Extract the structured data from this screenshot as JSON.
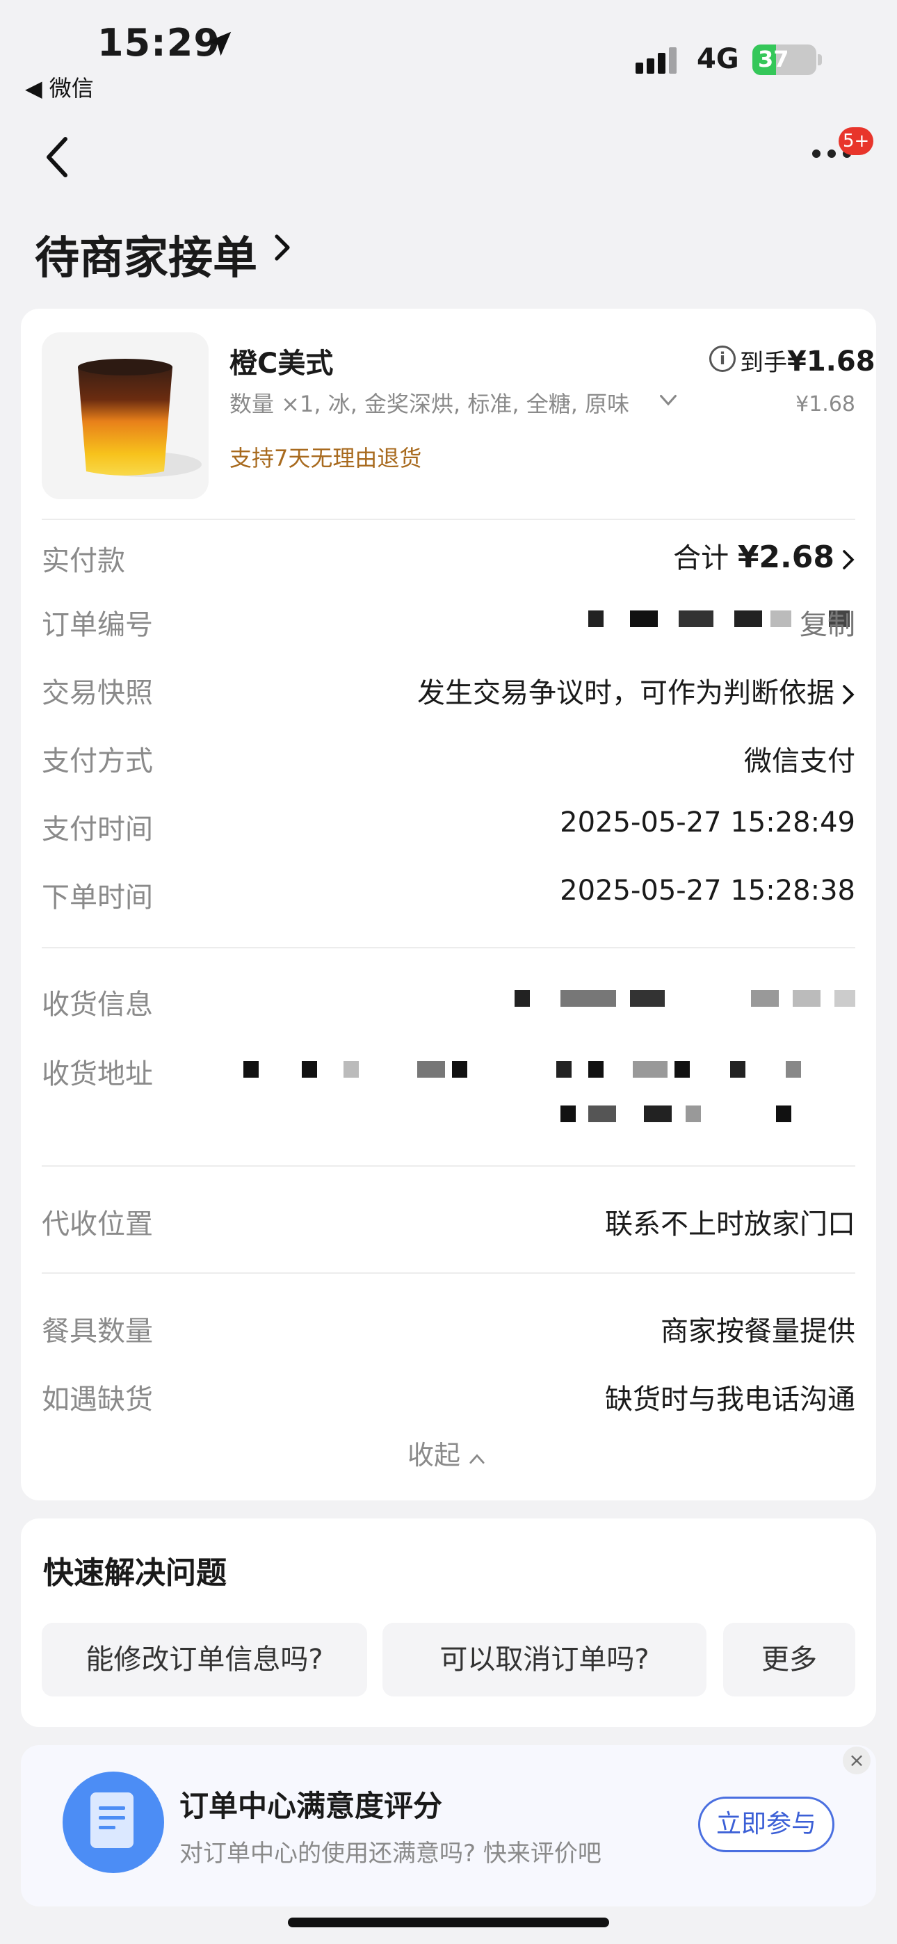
{
  "status_bar": {
    "time": "15:29",
    "back_app": "◀ 微信",
    "network": "4G",
    "battery": "37",
    "battery_level": 0.37
  },
  "nav": {
    "title": "待商家接单",
    "badge": "5+"
  },
  "product": {
    "name": "橙C美式",
    "spec": "数量 ×1, 冰, 金奖深烘, 标准, 全糖, 原味",
    "refund_note": "支持7天无理由退货",
    "receive_label": "到手",
    "receive_price": "¥1.68",
    "unit_price": "¥1.68"
  },
  "order": {
    "paid": {
      "label": "实付款",
      "prefix": "合计 ",
      "amount": "¥2.68"
    },
    "order_no": {
      "label": "订单编号",
      "value_tail": "复制"
    },
    "snapshot": {
      "label": "交易快照",
      "value": "发生交易争议时，可作为判断依据"
    },
    "pay_method": {
      "label": "支付方式",
      "value": "微信支付"
    },
    "pay_time": {
      "label": "支付时间",
      "value": "2025-05-27 15:28:49"
    },
    "order_time": {
      "label": "下单时间",
      "value": "2025-05-27 15:28:38"
    },
    "recipient": {
      "label": "收货信息"
    },
    "address": {
      "label": "收货地址"
    },
    "proxy": {
      "label": "代收位置",
      "value": "联系不上时放家门口"
    },
    "utensils": {
      "label": "餐具数量",
      "value": "商家按餐量提供"
    },
    "stockout": {
      "label": "如遇缺货",
      "value": "缺货时与我电话沟通"
    },
    "collapse": "收起"
  },
  "quick": {
    "title": "快速解决问题",
    "chips": [
      "能修改订单信息吗?",
      "可以取消订单吗?",
      "更多"
    ]
  },
  "survey": {
    "title": "订单中心满意度评分",
    "subtitle": "对订单中心的使用还满意吗? 快来评价吧",
    "button": "立即参与",
    "close": "×"
  },
  "colors": {
    "refund": "#a86a1e",
    "badge": "#e8352b",
    "button": "#3b5fd6",
    "battery": "#35c759"
  }
}
